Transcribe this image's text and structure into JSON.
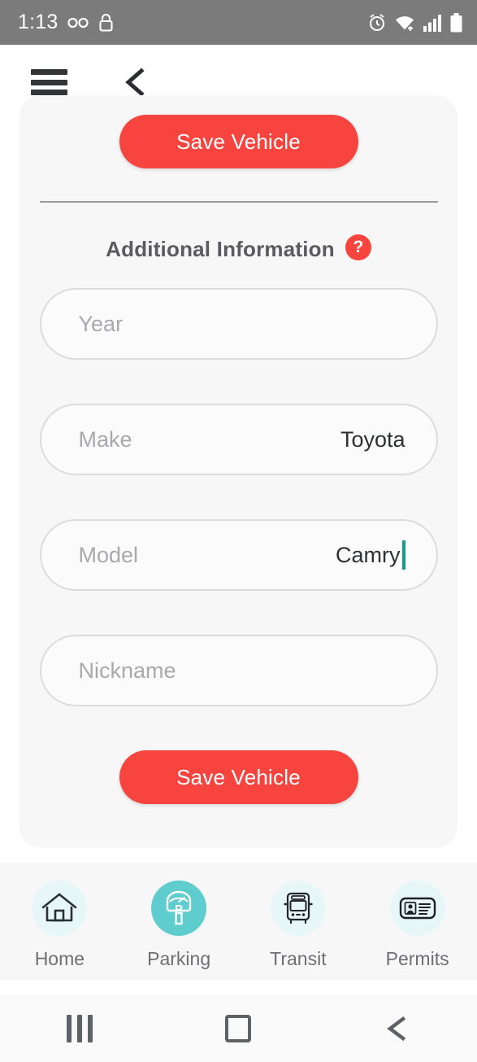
{
  "status_bar": {
    "time": "1:13",
    "left_icons": [
      "voicemail-icon",
      "lock-icon"
    ],
    "right_icons": [
      "alarm-icon",
      "wifi-icon",
      "signal-icon",
      "battery-icon"
    ]
  },
  "header": {
    "menu_icon": "hamburger-menu-icon",
    "back_icon": "back-chevron-icon"
  },
  "colors": {
    "primary_red": "#f7443e",
    "accent_teal": "#5fcdcd",
    "caret_teal": "#159c8c",
    "card_bg": "#f7f7f7",
    "status_bar_bg": "#7b7b7b"
  },
  "main": {
    "save_button_top_label": "Save Vehicle",
    "save_button_bottom_label": "Save Vehicle",
    "section_title": "Additional Information",
    "help_badge_label": "?",
    "fields": [
      {
        "label": "Year",
        "value": "",
        "focused": false
      },
      {
        "label": "Make",
        "value": "Toyota",
        "focused": false
      },
      {
        "label": "Model",
        "value": "Camry",
        "focused": true
      },
      {
        "label": "Nickname",
        "value": "",
        "focused": false
      }
    ]
  },
  "tabbar": {
    "tabs": [
      {
        "label": "Home",
        "icon": "house-icon",
        "active": false
      },
      {
        "label": "Parking",
        "icon": "parking-meter-icon",
        "active": true
      },
      {
        "label": "Transit",
        "icon": "bus-icon",
        "active": false
      },
      {
        "label": "Permits",
        "icon": "id-card-icon",
        "active": false
      }
    ]
  },
  "android_nav": {
    "recents_label": "recents-icon",
    "home_label": "home-square-icon",
    "back_label": "back-icon"
  }
}
